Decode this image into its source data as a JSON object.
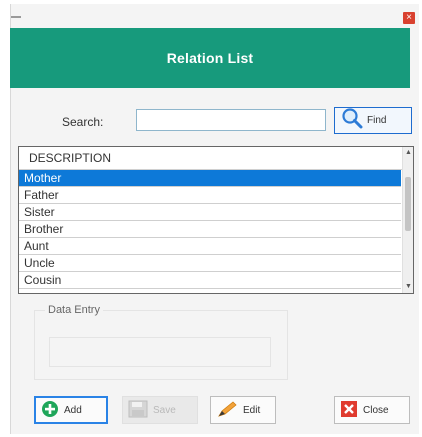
{
  "window": {
    "title": "Relation List",
    "close_glyph": "×",
    "close_icon": "close-x-icon"
  },
  "search": {
    "label": "Search:",
    "value": "",
    "placeholder": "",
    "find_label": "Find",
    "find_icon": "magnifier-icon"
  },
  "list": {
    "column_header": "DESCRIPTION",
    "selected_index": 0,
    "rows": [
      "Mother",
      "Father",
      "Sister",
      "Brother",
      "Aunt",
      "Uncle",
      "Cousin"
    ],
    "scroll_up_glyph": "▲",
    "scroll_down_glyph": "▼"
  },
  "data_entry": {
    "title": "Data Entry",
    "value": ""
  },
  "buttons": {
    "add": {
      "label": "Add",
      "icon": "plus-circle-icon"
    },
    "save": {
      "label": "Save",
      "icon": "floppy-disk-icon",
      "enabled": false
    },
    "edit": {
      "label": "Edit",
      "icon": "pencil-icon"
    },
    "close": {
      "label": "Close",
      "icon": "close-x-icon"
    }
  },
  "colors": {
    "banner": "#179a7c",
    "selection": "#0d79d8",
    "close_red": "#d9412f",
    "add_green": "#1fa65a",
    "focus_blue": "#2a83e6"
  }
}
